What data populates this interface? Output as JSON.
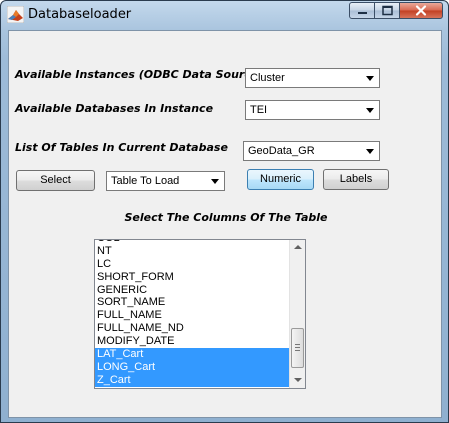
{
  "window": {
    "title": "Databaseloader",
    "controls": {
      "minimize": "minimize",
      "maximize": "maximize",
      "close": "close"
    }
  },
  "labels": {
    "instances": "Available Instances (ODBC Data Sources)",
    "databases": "Available Databases In Instance",
    "tables": "List Of Tables In Current Database",
    "columns_heading": "Select The Columns Of The Table"
  },
  "selects": {
    "instance": "Cluster",
    "database": "TEI",
    "table": "GeoData_GR",
    "load_type": "Table To Load"
  },
  "buttons": {
    "select": "Select",
    "numeric": "Numeric",
    "labels": "Labels"
  },
  "columns_list": {
    "items": [
      {
        "label": "COL"
      },
      {
        "label": "NT"
      },
      {
        "label": "LC"
      },
      {
        "label": "SHORT_FORM"
      },
      {
        "label": "GENERIC"
      },
      {
        "label": "SORT_NAME"
      },
      {
        "label": "FULL_NAME"
      },
      {
        "label": "FULL_NAME_ND"
      },
      {
        "label": "MODIFY_DATE"
      },
      {
        "label": "LAT_Cart",
        "selected": true
      },
      {
        "label": "LONG_Cart",
        "selected": true
      },
      {
        "label": "Z_Cart",
        "selected": true
      }
    ]
  },
  "colors": {
    "selection": "#3399ff",
    "client_background": "#f0f0f0",
    "frame": "#a9c4de"
  }
}
